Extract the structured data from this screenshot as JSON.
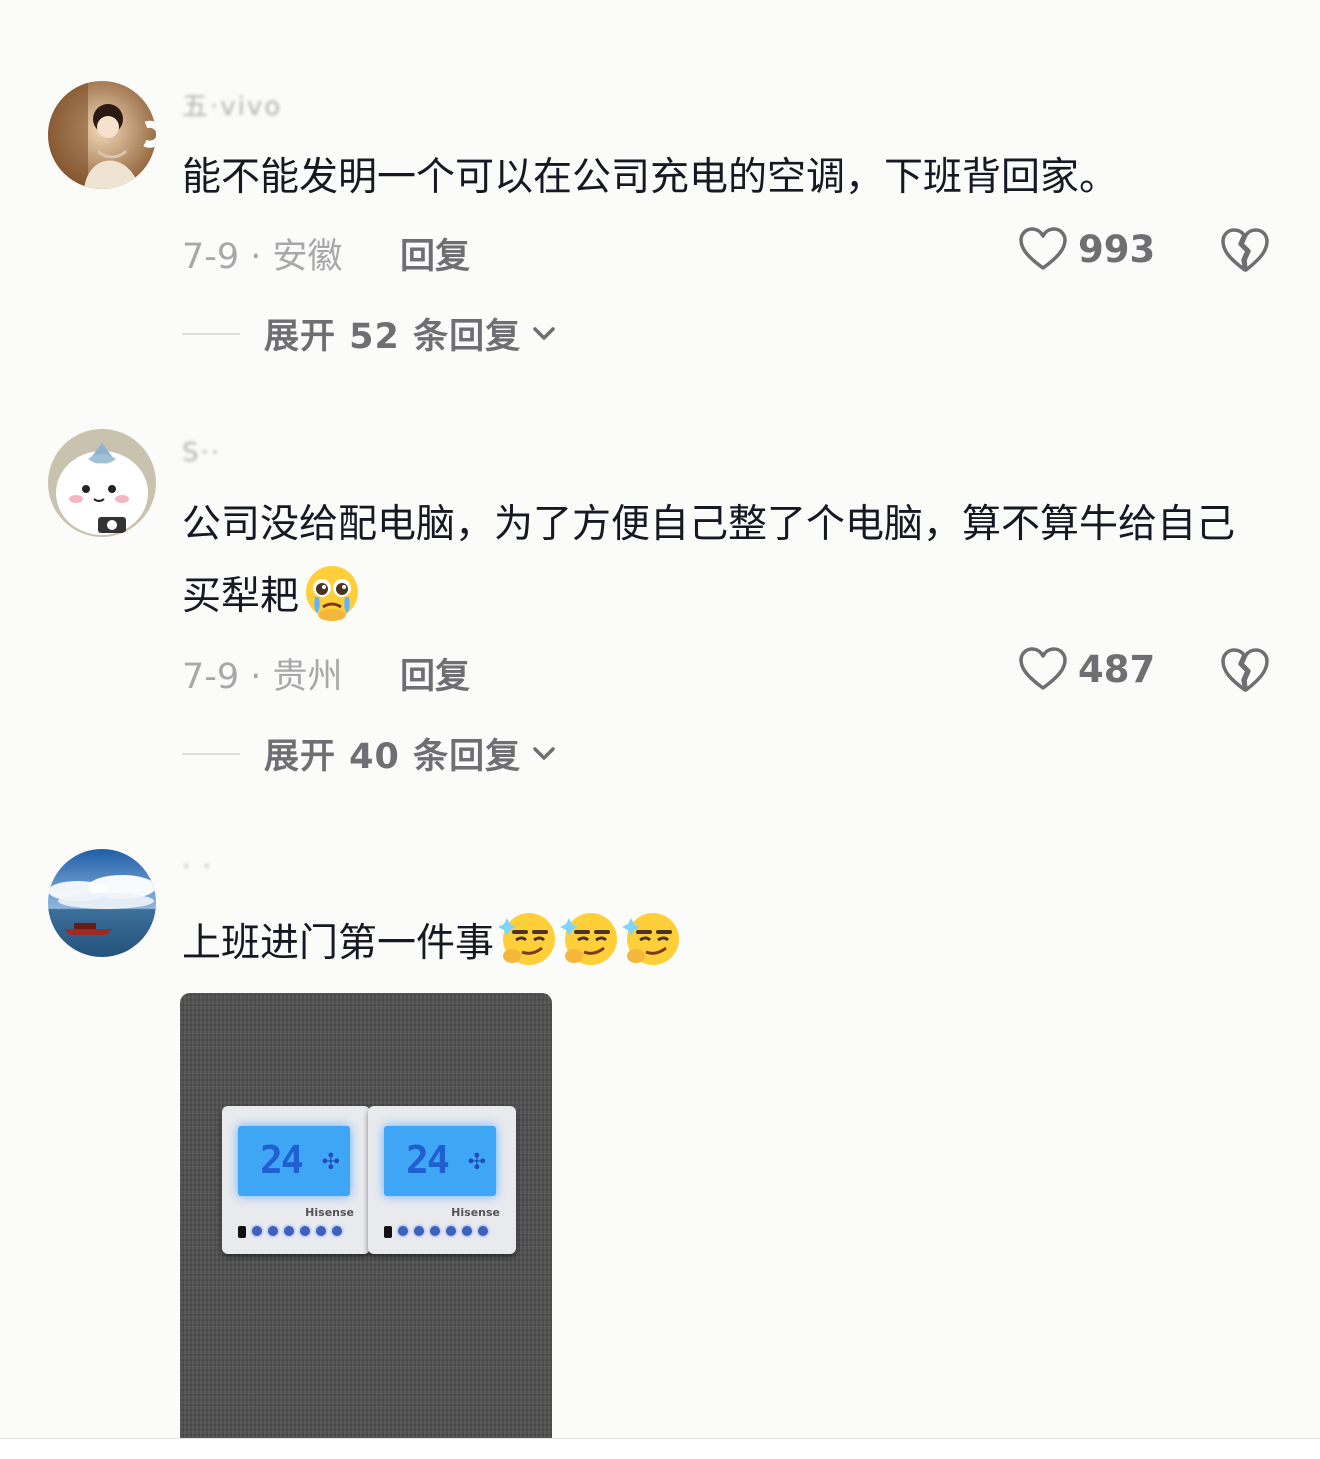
{
  "comments": [
    {
      "username": "五·vivo",
      "text": "能不能发明一个可以在公司充电的空调，下班背回家。",
      "date_location": "7-9 · 安徽",
      "reply_label": "回复",
      "likes": "993",
      "expand_label": "展开 52 条回复"
    },
    {
      "username": "S··",
      "text": "公司没给配电脑，为了方便自己整了个电脑，算不算牛给自己买犁耙",
      "date_location": "7-9 · 贵州",
      "reply_label": "回复",
      "likes": "487",
      "expand_label": "展开 40 条回复"
    },
    {
      "username": "·  ·",
      "text": "上班进门第一件事",
      "photo": {
        "thermostats": [
          {
            "temp": "24",
            "brand": "Hisense"
          },
          {
            "temp": "24",
            "brand": "Hisense"
          }
        ]
      }
    }
  ],
  "icons": {
    "like": "heart-outline-icon",
    "dislike": "broken-heart-icon",
    "chevron": "chevron-down-icon"
  },
  "colors": {
    "text": "#161823",
    "muted": "#a8a8ab",
    "action": "#6e6e73"
  }
}
